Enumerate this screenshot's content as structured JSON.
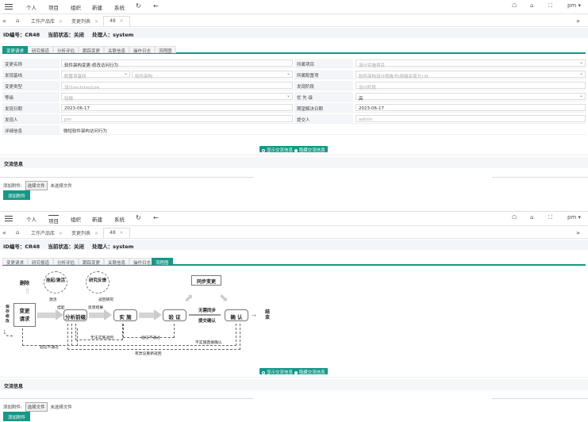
{
  "topnav": {
    "items": [
      "个人",
      "项目",
      "组织",
      "新建",
      "系统"
    ],
    "user": "pm"
  },
  "tabs": {
    "items": [
      "工作产品库",
      "变更列表",
      "48"
    ]
  },
  "info": {
    "id_label": "ID编号：CR48",
    "status_label": "当前状态：关闭",
    "handler_label": "处理人：system"
  },
  "subtabs": [
    "变更请求",
    "研究报道",
    "分析评估",
    "跟踪变更",
    "关联信息",
    "操作日志",
    "流程图"
  ],
  "form": {
    "change_name_label": "变更名称",
    "change_name": "软件架构变更-修改访问行为",
    "project_label": "所属项目",
    "project": "设计实施项目",
    "baseline_label": "发现基线",
    "baseline1": "配置项基线",
    "baseline2": "软件架构",
    "config_label": "所属配置项",
    "config": "软件架构设计规格书(规格实现方) N",
    "type_label": "变更类型",
    "type": "设计architecture",
    "stage_label": "发现阶段",
    "stage": "设计阶段",
    "level_label": "等级",
    "level": "轻微",
    "priority_label": "优 先 级",
    "priority": "高",
    "found_date_label": "发现日期",
    "found_date": "2023-06-17",
    "expected_date_label": "期望解决日期",
    "expected_date": "2023-06-17",
    "finder_label": "发现人",
    "finder": "pm",
    "submitter_label": "提交人",
    "submitter": "admin",
    "detail_label": "详细信息",
    "detail": "微短软件架构访问行为"
  },
  "toggle": {
    "show": "显示交流信息",
    "hide": "隐藏交流信息"
  },
  "comm_title": "交流信息",
  "upload": {
    "label": "添加附件:",
    "choose": "选择文件",
    "none": "未选择文件",
    "add_btn": "添加附件"
  },
  "flow": {
    "delete": "删除",
    "suspend": "挂起/激活",
    "research": "研究反馈",
    "sync": "同步变更",
    "save_modify": "保存修改",
    "request": "变更请求",
    "analyze": "分析前缀",
    "implement": "实 施",
    "verify": "验 证",
    "confirm": "确 认",
    "end": "结束",
    "activate": "激活",
    "suspend_short": "挂起",
    "back_research": "返回研究",
    "feedback_result": "反馈结果",
    "no_sync": "无需同步",
    "submit_confirm": "提交确认",
    "verify_fail": "验证不通过",
    "no_impl_return": "无法实施返回",
    "verify_fail2": "验证不通过",
    "no_impl_confirm": "不实施直接确认",
    "problem_reanalyze": "有异议重新返回"
  }
}
